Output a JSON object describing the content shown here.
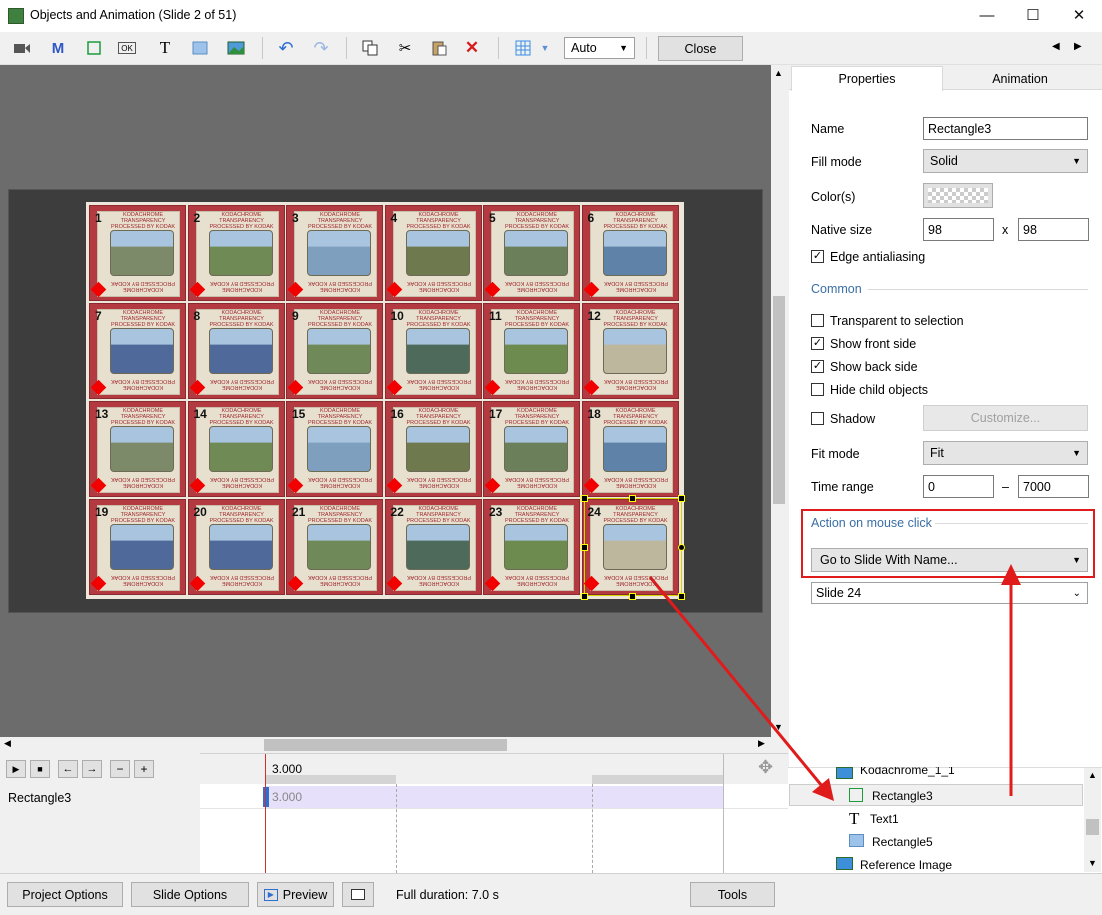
{
  "window": {
    "title": "Objects and Animation (Slide 2 of 51)",
    "minimize": "—",
    "maximize": "☐",
    "close": "✕"
  },
  "toolbar": {
    "zoom_value": "Auto",
    "close_label": "Close",
    "undo": "↶",
    "redo": "↷",
    "delete": "✕",
    "text_tool": "T",
    "m_tool": "M",
    "ok_tool": "OK",
    "prev": "◀",
    "next": "▶"
  },
  "slides": {
    "tiles": [
      {
        "num": "1",
        "pic": "#7c8a6a"
      },
      {
        "num": "2",
        "pic": "#6f8a55"
      },
      {
        "num": "3",
        "pic": "#7f9fbf"
      },
      {
        "num": "4",
        "pic": "#6e7a4e"
      },
      {
        "num": "5",
        "pic": "#6b7f5a"
      },
      {
        "num": "6",
        "pic": "#5e82a8"
      },
      {
        "num": "7",
        "pic": "#4f6a9a"
      },
      {
        "num": "8",
        "pic": "#4f6a9a"
      },
      {
        "num": "9",
        "pic": "#6f8a58"
      },
      {
        "num": "10",
        "pic": "#4d6a5a"
      },
      {
        "num": "11",
        "pic": "#6d8a4f"
      },
      {
        "num": "12",
        "pic": "#bdb79e"
      },
      {
        "num": "13",
        "pic": "#7c8a6a"
      },
      {
        "num": "14",
        "pic": "#6f8a55"
      },
      {
        "num": "15",
        "pic": "#7f9fbf"
      },
      {
        "num": "16",
        "pic": "#6e7a4e"
      },
      {
        "num": "17",
        "pic": "#6b7f5a"
      },
      {
        "num": "18",
        "pic": "#5e82a8"
      },
      {
        "num": "19",
        "pic": "#4f6a9a"
      },
      {
        "num": "20",
        "pic": "#4f6a9a"
      },
      {
        "num": "21",
        "pic": "#6f8a58"
      },
      {
        "num": "22",
        "pic": "#4d6a5a"
      },
      {
        "num": "23",
        "pic": "#6d8a4f"
      },
      {
        "num": "24",
        "pic": "#bdb79e"
      }
    ],
    "brand_top": "KODACHROME TRANSPARENCY PROCESSED BY KODAK",
    "brand_bottom": "KODACHROME PROCESSED BY KODAK"
  },
  "tabs": {
    "properties": "Properties",
    "animation": "Animation"
  },
  "props": {
    "name_label": "Name",
    "name_value": "Rectangle3",
    "fill_label": "Fill mode",
    "fill_value": "Solid",
    "colors_label": "Color(s)",
    "native_label": "Native size",
    "native_w": "98",
    "native_x": "x",
    "native_h": "98",
    "edge_label": "Edge antialiasing",
    "common_label": "Common",
    "transparent_label": "Transparent to selection",
    "front_label": "Show front side",
    "back_label": "Show back side",
    "hide_child_label": "Hide child objects",
    "shadow_label": "Shadow",
    "customize_label": "Customize...",
    "fit_label": "Fit mode",
    "fit_value": "Fit",
    "time_label": "Time range",
    "time_from": "0",
    "time_dash": "–",
    "time_to": "7000",
    "action_label": "Action on mouse click",
    "action_value": "Go to Slide With Name...",
    "slide_name_value": "Slide 24"
  },
  "checks": {
    "edge": true,
    "transparent": false,
    "front": true,
    "back": true,
    "hide_child": false,
    "shadow": false
  },
  "timeline": {
    "time_marker": "3.000",
    "object_label": "Rectangle3",
    "bar_value": "3.000"
  },
  "tree": {
    "items": [
      {
        "label": "Kodachrome_1_1"
      },
      {
        "label": "Rectangle3"
      },
      {
        "label": "Text1"
      },
      {
        "label": "Rectangle5"
      },
      {
        "label": "Reference Image"
      }
    ]
  },
  "status": {
    "project_options": "Project Options",
    "slide_options": "Slide Options",
    "preview": "Preview",
    "duration": "Full duration: 7.0 s",
    "tools": "Tools"
  },
  "colors": {
    "accent_red": "#e01b1b",
    "link_blue": "#3a6ea5",
    "mount_red": "#b23a40"
  }
}
